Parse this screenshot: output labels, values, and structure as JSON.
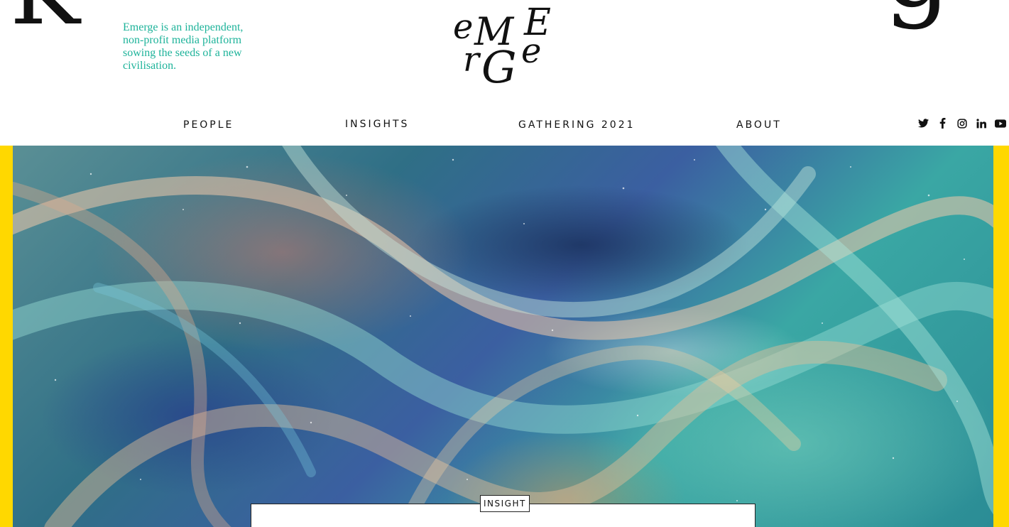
{
  "header": {
    "giant_left_letter": "K",
    "giant_right_letter": "g",
    "tagline": "Emerge is an independent, non-profit media platform sowing the seeds of a new civilisation.",
    "logo": {
      "letters": [
        "e",
        "M",
        "E",
        "r",
        "G",
        "e"
      ]
    }
  },
  "nav": {
    "items": [
      {
        "label": "PEOPLE"
      },
      {
        "label": "INSIGHTS"
      },
      {
        "label": "GATHERING 2021"
      },
      {
        "label": "ABOUT"
      }
    ]
  },
  "social": {
    "icons": [
      "twitter-icon",
      "facebook-icon",
      "instagram-icon",
      "linkedin-icon",
      "youtube-icon"
    ]
  },
  "hero": {
    "frame_color": "#ffd800",
    "badge_label": "INSIGHT"
  },
  "colors": {
    "accent": "#1eb39a",
    "text": "#111111",
    "frame": "#ffd800"
  }
}
